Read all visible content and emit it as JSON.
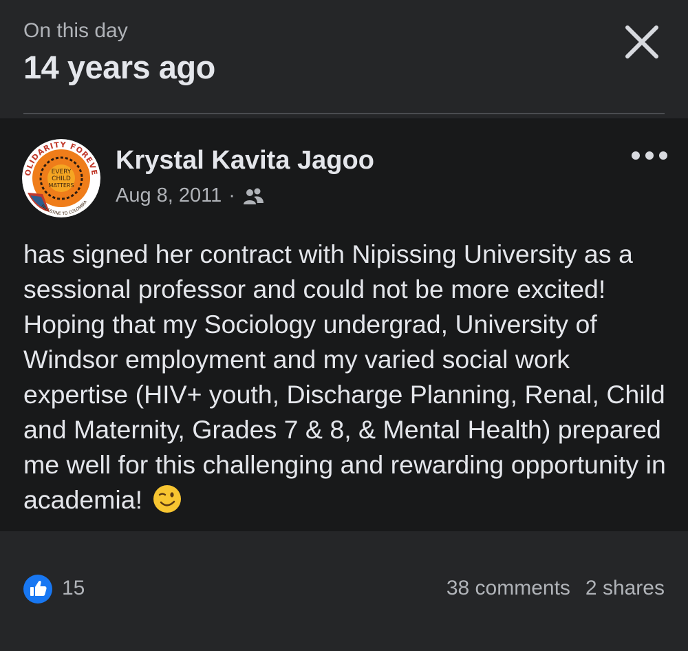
{
  "memory": {
    "kicker": "On this day",
    "headline": "14 years ago"
  },
  "post": {
    "author": "Krystal Kavita Jagoo",
    "date": "Aug 8, 2011",
    "separator": "·",
    "audience_icon": "friends-icon",
    "text": "has signed her contract with Nipissing University as a sessional professor and could not be more excited! Hoping that my Sociology undergrad, University of Windsor employment and my varied social work expertise (HIV+ youth, Discharge Planning, Renal, Child and Maternity, Grades 7 & 8, & Mental Health) prepared me well for this challenging and rewarding opportunity in academia!",
    "emoji": "winking-face-emoji",
    "avatar": {
      "top_text": "SOLIDARITY FOREVER",
      "center_text": [
        "EVERY",
        "CHILD",
        "MATTERS"
      ],
      "bottom_text": "PALESTINE TO COLOMBIA"
    }
  },
  "reactions": {
    "like_count": "15",
    "comments": "38 comments",
    "shares": "2 shares"
  },
  "colors": {
    "accent": "#1877f2",
    "background": "#252628",
    "post_background": "#18191a",
    "text_primary": "#e4e6eb",
    "text_secondary": "#b0b3b8"
  }
}
